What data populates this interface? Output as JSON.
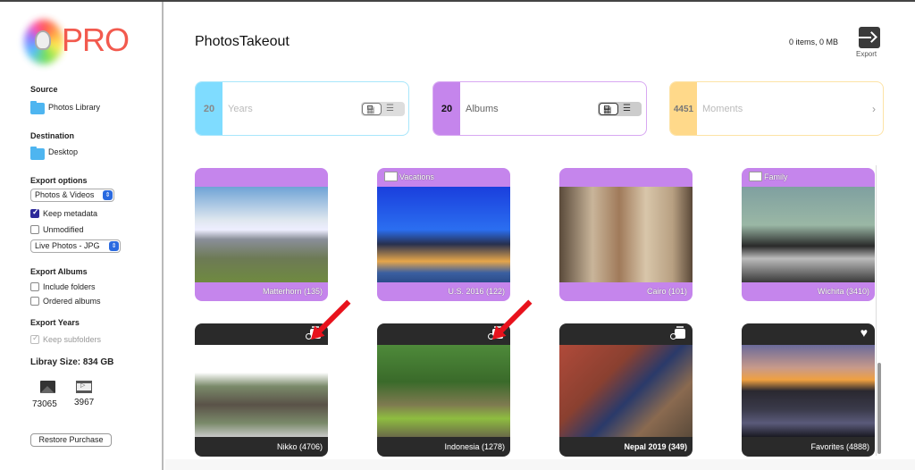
{
  "app": {
    "logo_text": "PRO",
    "title": "PhotosTakeout"
  },
  "sidebar": {
    "source": {
      "heading": "Source",
      "value": "Photos Library"
    },
    "destination": {
      "heading": "Destination",
      "value": "Desktop"
    },
    "export_options": {
      "heading": "Export options",
      "media_select": "Photos & Videos",
      "keep_metadata": {
        "label": "Keep metadata",
        "checked": true
      },
      "unmodified": {
        "label": "Unmodified",
        "checked": false
      },
      "live_photos_select": "Live Photos - JPG"
    },
    "export_albums": {
      "heading": "Export Albums",
      "include_folders": {
        "label": "Include folders",
        "checked": false
      },
      "ordered_albums": {
        "label": "Ordered albums",
        "checked": false
      }
    },
    "export_years": {
      "heading": "Export Years",
      "keep_subfolders": {
        "label": "Keep subfolders",
        "checked": true,
        "disabled": true
      }
    },
    "library_size": "Libray Size: 834 GB",
    "photo_count": "73065",
    "video_count": "3967",
    "restore_button": "Restore Purchase"
  },
  "header": {
    "items_summary": "0 items, 0 MB",
    "export_label": "Export"
  },
  "categories": [
    {
      "count": "20",
      "label": "Years",
      "color": "#7fdcff",
      "border": "#a8e6fb",
      "active": false,
      "control": "view-toggle"
    },
    {
      "count": "20",
      "label": "Albums",
      "color": "#c585ec",
      "border": "#d8a8f2",
      "active": true,
      "control": "view-toggle"
    },
    {
      "count": "4451",
      "label": "Moments",
      "color": "#ffd98a",
      "border": "#fde3a6",
      "active": false,
      "control": "chevron",
      "chevron": "›"
    }
  ],
  "albums": [
    {
      "name": "Matterhorn (135)",
      "folder": "",
      "style": "purple",
      "badge": "",
      "photo": "mountain"
    },
    {
      "name": "U.S. 2016 (122)",
      "folder": "Vacations",
      "style": "purple",
      "badge": "",
      "photo": "city"
    },
    {
      "name": "Cairo  (101)",
      "folder": "",
      "style": "purple",
      "badge": "",
      "photo": "people"
    },
    {
      "name": "Wichita (3410)",
      "folder": "Family",
      "style": "purple",
      "badge": "",
      "photo": "screen"
    },
    {
      "name": "Nikko (4706)",
      "folder": "",
      "style": "dark",
      "badge": "shared-stack",
      "photo": "shrine"
    },
    {
      "name": "Indonesia (1278)",
      "folder": "",
      "style": "dark",
      "badge": "shared-stack",
      "photo": "lilypads"
    },
    {
      "name": "Nepal 2019 (349)",
      "folder": "",
      "style": "dark",
      "badge": "shared-stack",
      "photo": "dinner"
    },
    {
      "name": "Favorites (4888)",
      "folder": "",
      "style": "dark",
      "badge": "heart",
      "photo": "sunset"
    }
  ],
  "annotations": {
    "arrow_color": "#e8121c",
    "arrow_count": 2
  }
}
